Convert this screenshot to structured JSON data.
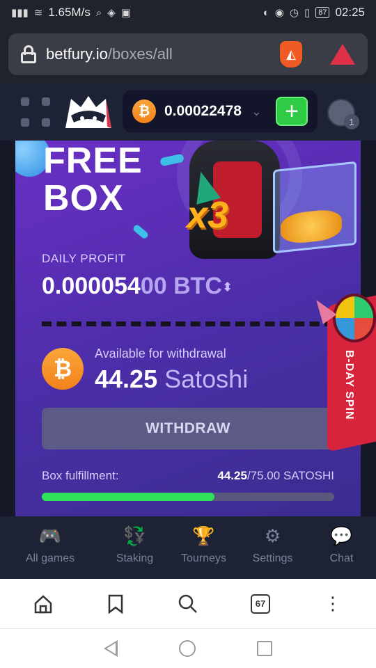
{
  "status_bar": {
    "speed": "1.65M/s",
    "battery": "87",
    "time": "02:25"
  },
  "browser": {
    "url_domain": "betfury.io",
    "url_path": "/boxes/all",
    "tab_count": "67"
  },
  "header": {
    "balance": "0.00022478",
    "coin_symbol": "₿",
    "notification_count": "1"
  },
  "box": {
    "title_line1": "FREE",
    "title_line2": "BOX",
    "multiplier": "x3",
    "daily_profit_label": "DAILY PROFIT",
    "daily_profit_bright": "0.000054",
    "daily_profit_dim": "00",
    "daily_profit_unit": "BTC",
    "available_label": "Available for withdrawal",
    "available_value": "44.25",
    "available_unit": "Satoshi",
    "withdraw_label": "WITHDRAW",
    "fulfillment_label": "Box fulfillment:",
    "fulfillment_current": "44.25",
    "fulfillment_total": "/75.00 SATOSHI",
    "fulfillment_fraction": 0.59,
    "bday_spin_label": "B-DAY SPIN"
  },
  "app_nav": [
    {
      "label": "All games",
      "icon": "gamepad-icon",
      "glyph": "🎮"
    },
    {
      "label": "Staking",
      "icon": "staking-icon",
      "glyph": "💱"
    },
    {
      "label": "Tourneys",
      "icon": "trophy-icon",
      "glyph": "🏆"
    },
    {
      "label": "Settings",
      "icon": "gear-icon",
      "glyph": "⚙"
    },
    {
      "label": "Chat",
      "icon": "chat-icon",
      "glyph": "💬"
    }
  ],
  "colors": {
    "accent_green": "#2fcb45",
    "card_purple": "#6a2fc5",
    "bitcoin_orange": "#f2831b"
  }
}
